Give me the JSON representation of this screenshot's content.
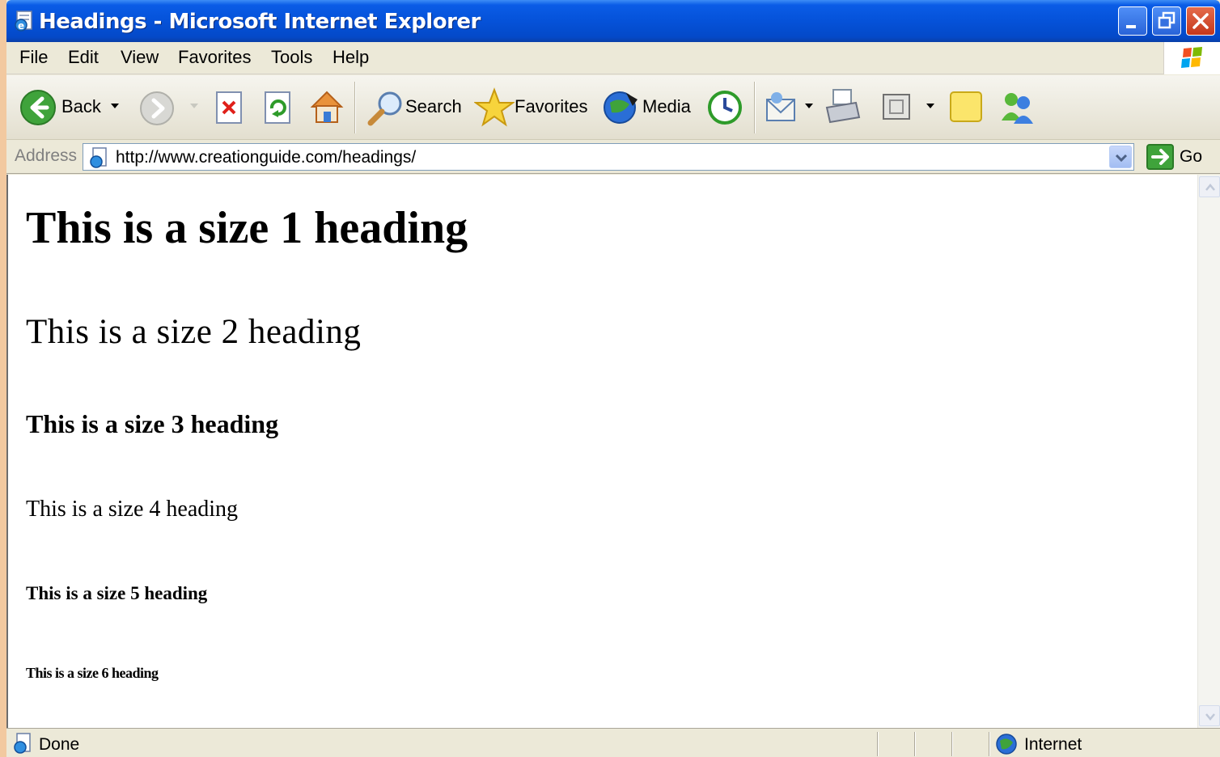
{
  "window": {
    "title": "Headings - Microsoft Internet Explorer"
  },
  "menu": [
    "File",
    "Edit",
    "View",
    "Favorites",
    "Tools",
    "Help"
  ],
  "toolbar": {
    "back_label": "Back",
    "search_label": "Search",
    "favorites_label": "Favorites",
    "media_label": "Media"
  },
  "address": {
    "label": "Address",
    "url": "http://www.creationguide.com/headings/",
    "go_label": "Go"
  },
  "page": {
    "headings": [
      "This is a size 1 heading",
      "This is a size 2 heading",
      "This is a size 3 heading",
      "This is a size 4 heading",
      "This is a size 5 heading",
      "This is a size 6 heading"
    ]
  },
  "status": {
    "text": "Done",
    "zone": "Internet"
  },
  "colors": {
    "titlebar": "#0552d9",
    "close_button": "#c5371b",
    "chrome": "#ece9d8"
  }
}
